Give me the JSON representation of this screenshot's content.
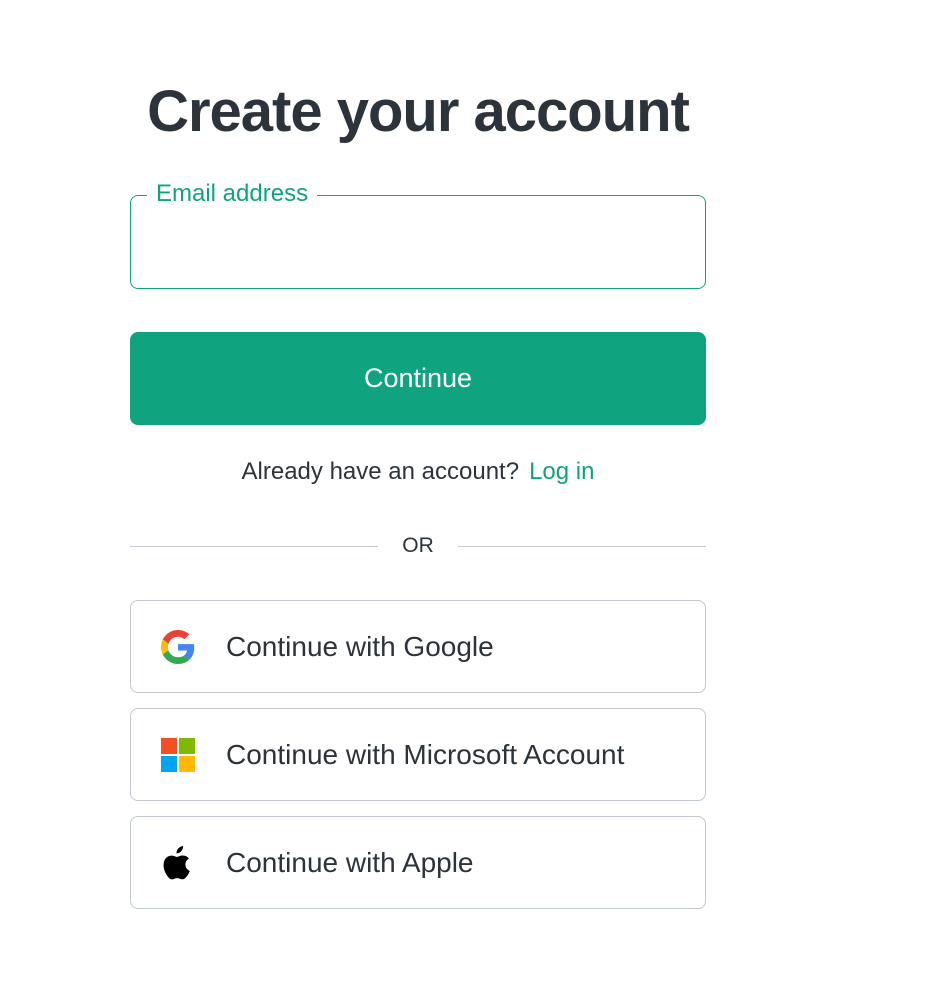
{
  "header": {
    "title": "Create your account"
  },
  "email_field": {
    "label": "Email address",
    "value": "",
    "placeholder": ""
  },
  "continue_button": {
    "label": "Continue"
  },
  "login_prompt": {
    "text": "Already have an account?",
    "link_label": "Log in"
  },
  "divider": {
    "label": "OR"
  },
  "social": [
    {
      "label": "Continue with Google",
      "icon": "google-icon"
    },
    {
      "label": "Continue with Microsoft Account",
      "icon": "microsoft-icon"
    },
    {
      "label": "Continue with Apple",
      "icon": "apple-icon"
    }
  ],
  "colors": {
    "accent": "#10a37f",
    "text": "#2d333a",
    "border": "#c2c8d0",
    "background": "#ffffff",
    "microsoft_red": "#f25022",
    "microsoft_green": "#7fba00",
    "microsoft_blue": "#00a4ef",
    "microsoft_yellow": "#ffb900"
  }
}
